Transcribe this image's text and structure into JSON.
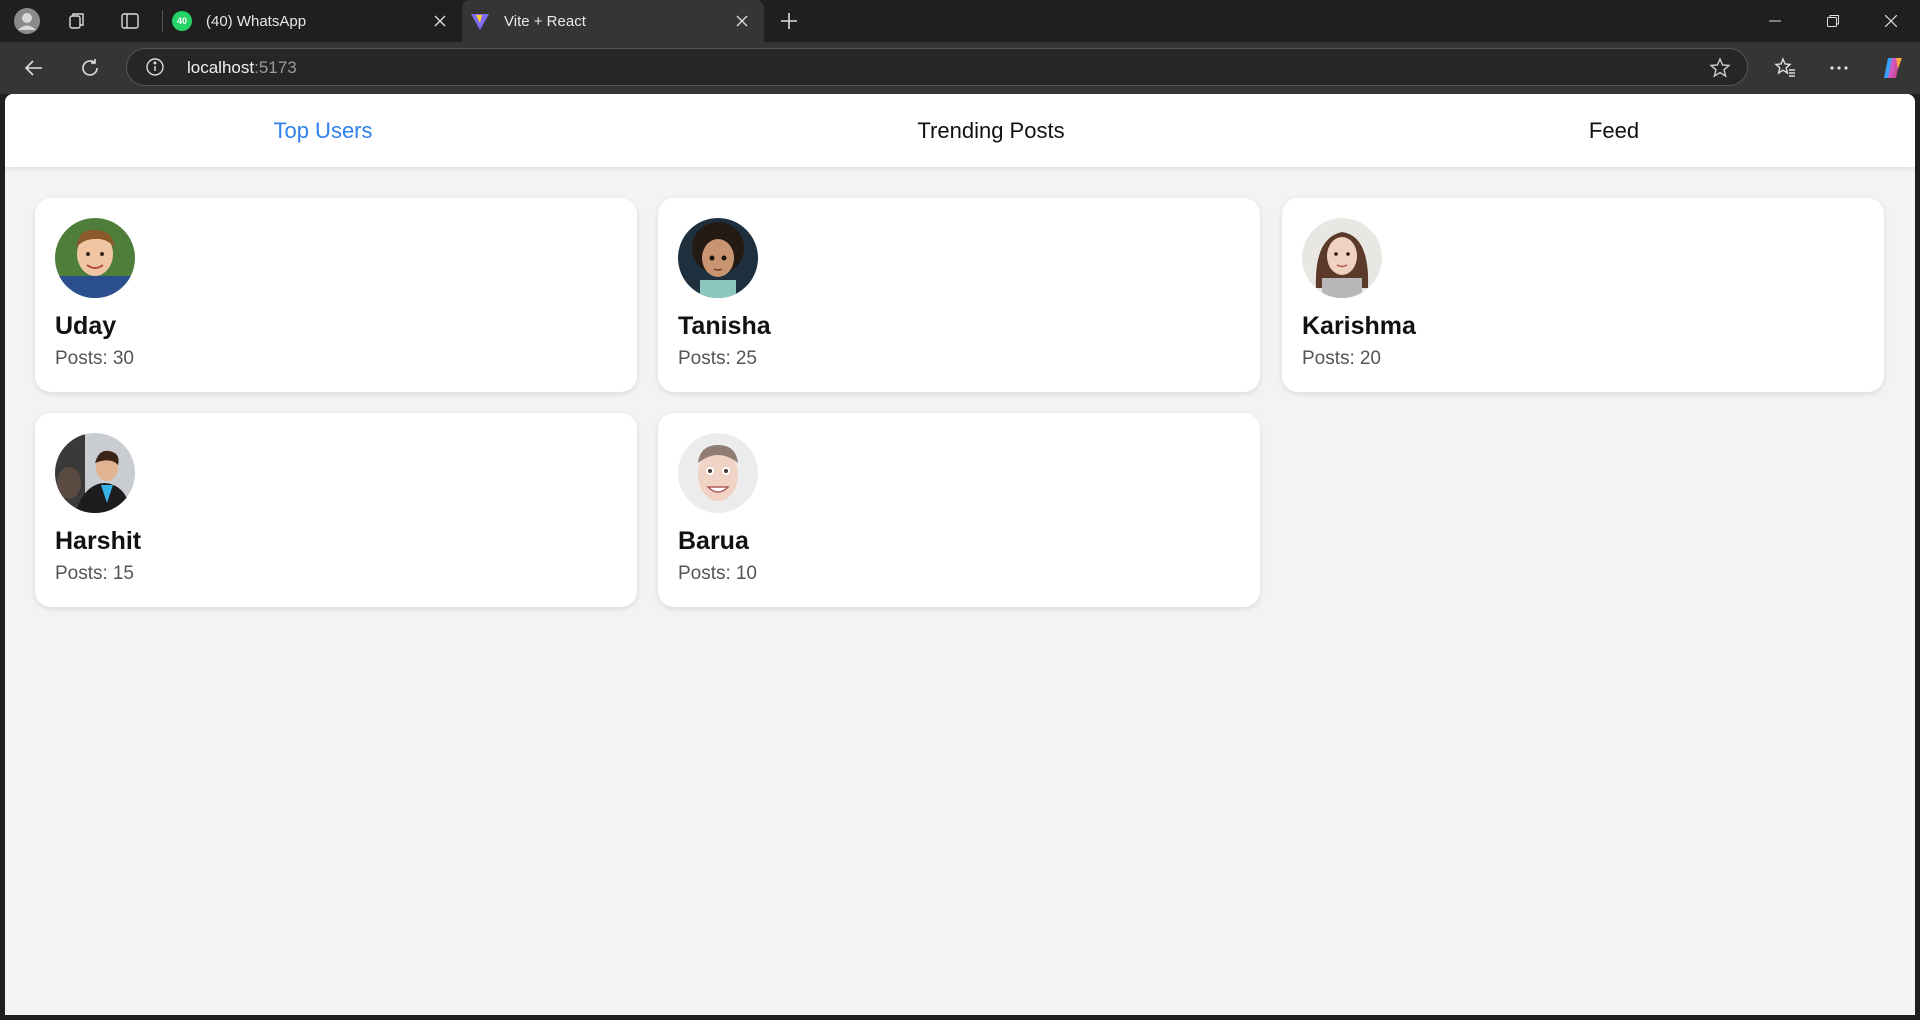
{
  "browser": {
    "tabs": [
      {
        "title": "(40) WhatsApp",
        "badge": "40",
        "favicon": "whatsapp-icon"
      },
      {
        "title": "Vite + React",
        "favicon": "vite-icon"
      }
    ],
    "url_host": "localhost",
    "url_port": ":5173"
  },
  "nav": {
    "items": [
      {
        "label": "Top Users"
      },
      {
        "label": "Trending Posts"
      },
      {
        "label": "Feed"
      }
    ],
    "active": "Top Users",
    "active_color": "#2f80ed"
  },
  "users": [
    {
      "name": "Uday",
      "posts_label": "Posts:",
      "posts": 30
    },
    {
      "name": "Tanisha",
      "posts_label": "Posts:",
      "posts": 25
    },
    {
      "name": "Karishma",
      "posts_label": "Posts:",
      "posts": 20
    },
    {
      "name": "Harshit",
      "posts_label": "Posts:",
      "posts": 15
    },
    {
      "name": "Barua",
      "posts_label": "Posts:",
      "posts": 10
    }
  ]
}
